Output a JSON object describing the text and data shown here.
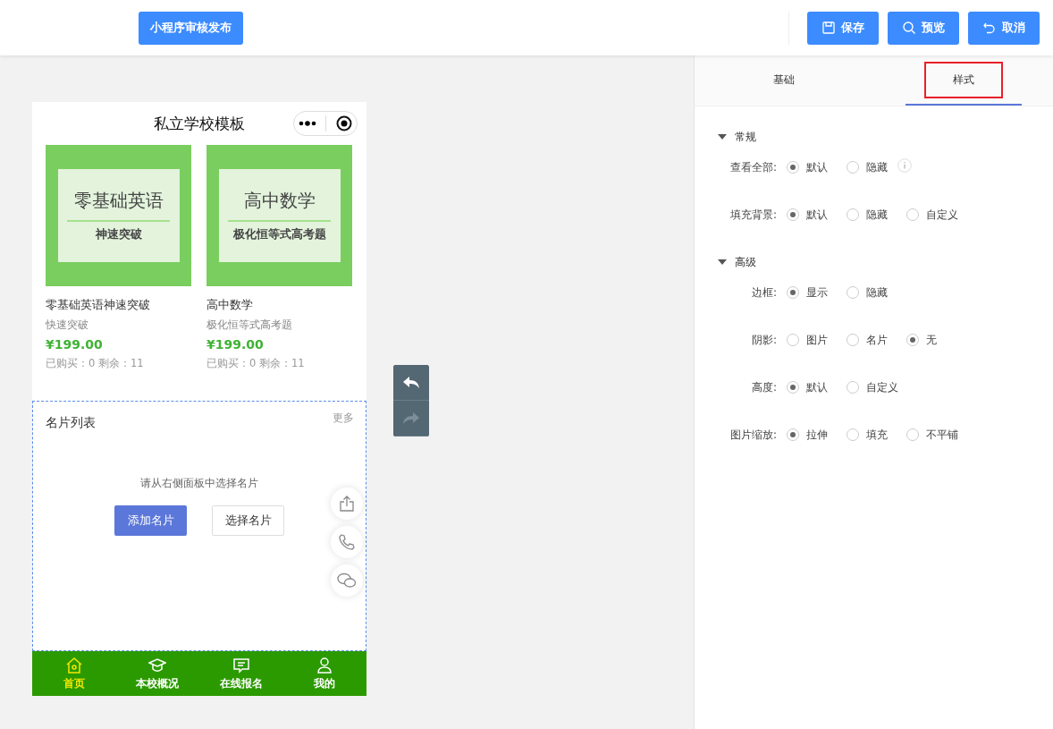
{
  "toolbar": {
    "publish_button": "小程序审核发布",
    "actions": [
      {
        "kind": "save",
        "label": "保存"
      },
      {
        "kind": "preview",
        "label": "预览"
      },
      {
        "kind": "cancel",
        "label": "取消"
      }
    ]
  },
  "phone": {
    "title": "私立学校模板",
    "courses": [
      {
        "banner_title": "零基础英语",
        "banner_subtitle": "神速突破",
        "name": "零基础英语神速突破",
        "subtitle": "快速突破",
        "price": "¥199.00",
        "stats": "已购买：0 剩余：11"
      },
      {
        "banner_title": "高中数学",
        "banner_subtitle": "极化恒等式高考题",
        "name": "高中数学",
        "subtitle": "极化恒等式高考题",
        "price": "¥199.00",
        "stats": "已购买：0 剩余：11"
      }
    ],
    "card_list": {
      "title": "名片列表",
      "more": "更多",
      "hint": "请从右侧面板中选择名片",
      "add_button": "添加名片",
      "select_button": "选择名片"
    },
    "floating": [
      {
        "kind": "share"
      },
      {
        "kind": "phone"
      },
      {
        "kind": "chat"
      }
    ],
    "tabbar": [
      {
        "kind": "home",
        "label": "首页",
        "selected": true
      },
      {
        "kind": "school",
        "label": "本校概况",
        "selected": false
      },
      {
        "kind": "message",
        "label": "在线报名",
        "selected": false
      },
      {
        "kind": "user",
        "label": "我的",
        "selected": false
      }
    ]
  },
  "history": [
    {
      "kind": "undo",
      "disabled": false
    },
    {
      "kind": "redo",
      "disabled": true
    }
  ],
  "panel": {
    "tabs": [
      {
        "label": "基础",
        "selected": false,
        "highlighted": false
      },
      {
        "label": "样式",
        "selected": true,
        "highlighted": true
      }
    ],
    "sections": [
      {
        "title": "常规",
        "expanded": true,
        "rows": [
          {
            "label": "查看全部:",
            "info": true,
            "options": [
              {
                "label": "默认",
                "selected": true
              },
              {
                "label": "隐藏",
                "selected": false
              }
            ]
          },
          {
            "label": "填充背景:",
            "info": false,
            "options": [
              {
                "label": "默认",
                "selected": true
              },
              {
                "label": "隐藏",
                "selected": false
              },
              {
                "label": "自定义",
                "selected": false
              }
            ]
          }
        ]
      },
      {
        "title": "高级",
        "expanded": true,
        "rows": [
          {
            "label": "边框:",
            "info": false,
            "options": [
              {
                "label": "显示",
                "selected": true
              },
              {
                "label": "隐藏",
                "selected": false
              }
            ]
          },
          {
            "label": "阴影:",
            "info": false,
            "options": [
              {
                "label": "图片",
                "selected": false
              },
              {
                "label": "名片",
                "selected": false
              },
              {
                "label": "无",
                "selected": true
              }
            ]
          },
          {
            "label": "高度:",
            "info": false,
            "options": [
              {
                "label": "默认",
                "selected": true
              },
              {
                "label": "自定义",
                "selected": false
              }
            ]
          },
          {
            "label": "图片缩放:",
            "info": false,
            "options": [
              {
                "label": "拉伸",
                "selected": true
              },
              {
                "label": "填充",
                "selected": false
              },
              {
                "label": "不平铺",
                "selected": false
              }
            ]
          }
        ]
      }
    ]
  }
}
